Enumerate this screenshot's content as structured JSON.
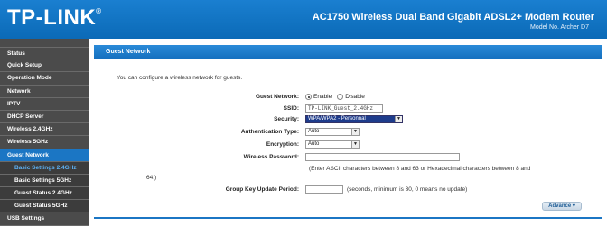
{
  "header": {
    "logo": "TP-LINK",
    "logo_mark": "®",
    "product_title": "AC1750 Wireless Dual Band Gigabit ADSL2+ Modem Router",
    "model_no": "Model No. Archer D7"
  },
  "sidebar": {
    "items": [
      {
        "label": "Status"
      },
      {
        "label": "Quick Setup"
      },
      {
        "label": "Operation Mode"
      },
      {
        "label": "Network"
      },
      {
        "label": "IPTV"
      },
      {
        "label": "DHCP Server"
      },
      {
        "label": "Wireless 2.4GHz"
      },
      {
        "label": "Wireless 5GHz"
      },
      {
        "label": "Guest Network"
      },
      {
        "label": "Basic Settings 2.4GHz"
      },
      {
        "label": "Basic Settings 5GHz"
      },
      {
        "label": "Guest Status 2.4GHz"
      },
      {
        "label": "Guest Status 5GHz"
      },
      {
        "label": "USB Settings"
      }
    ]
  },
  "main": {
    "section_title": "Guest Network",
    "intro": "You can configure a wireless network for guests.",
    "guest_network": {
      "label": "Guest Network:",
      "enable_label": "Enable",
      "disable_label": "Disable",
      "selected": "Enable"
    },
    "ssid": {
      "label": "SSID:",
      "value": "TP-LINK_Guest_2.4GHz"
    },
    "security": {
      "label": "Security:",
      "value": "WPA/WPA2 - Personnal"
    },
    "auth_type": {
      "label": "Authentication Type:",
      "value": "Auto"
    },
    "encryption": {
      "label": "Encryption:",
      "value": "Auto"
    },
    "wireless_password": {
      "label": "Wireless Password:",
      "value": "",
      "hint_line1": "(Enter ASCII characters between 8 and 63 or Hexadecimal characters between 8 and",
      "hint_line2": "64.)"
    },
    "group_key": {
      "label": "Group Key Update Period:",
      "value": "",
      "hint": "(seconds, minimum is 30, 0 means no update)"
    },
    "advance_button": "Advance"
  },
  "icons": {
    "dropdown": "chevron-down-icon",
    "radio": "radio-icon"
  },
  "colors": {
    "brand_blue": "#1b76c4",
    "sidebar_bg": "#4b4b4b",
    "active_sub_text": "#5db0f2"
  }
}
